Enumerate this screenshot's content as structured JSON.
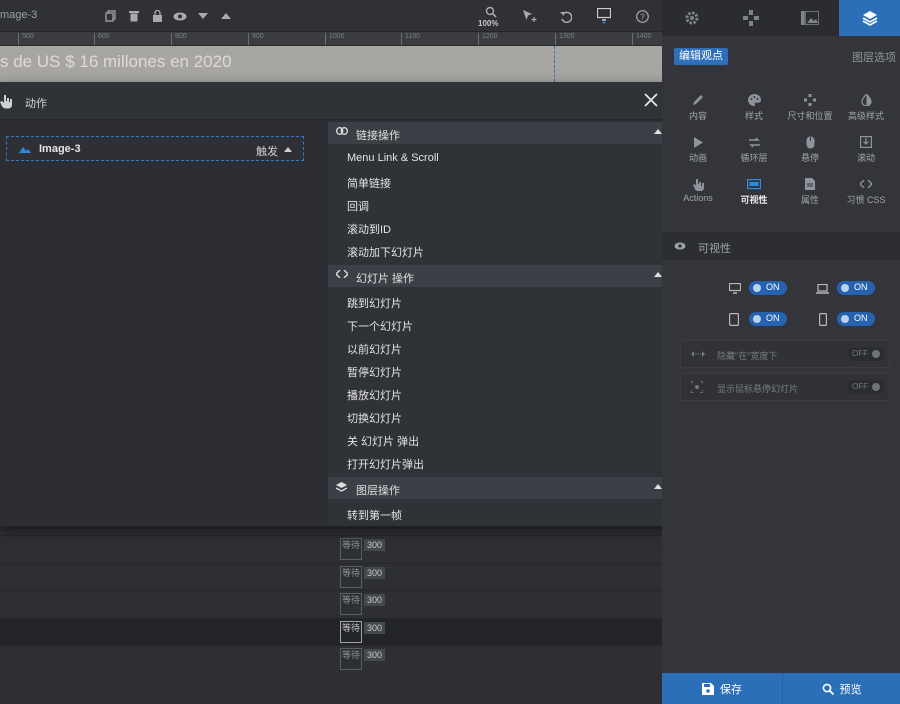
{
  "toolbar": {
    "layer_title": "mage-3",
    "zoom": "100%"
  },
  "ruler": {
    "ticks": [
      "500",
      "600",
      "800",
      "900",
      "1000",
      "1100",
      "1200",
      "1300",
      "1400"
    ]
  },
  "canvas": {
    "headline": "s de US $ 16 millones en 2020"
  },
  "modal": {
    "title": "动作",
    "trigger": {
      "layer_name": "Image-3",
      "trigger_label": "触发"
    },
    "sections": [
      {
        "title": "链接操作",
        "icon": "link-icon",
        "items": [
          "Menu Link & Scroll",
          "简单链接",
          "回调",
          "滚动到ID",
          "滚动加下幻灯片"
        ]
      },
      {
        "title": "幻灯片 操作",
        "icon": "code-icon",
        "items": [
          "跳到幻灯片",
          "下一个幻灯片",
          "以前幻灯片",
          "暂停幻灯片",
          "播放幻灯片",
          "切换幻灯片",
          "关 幻灯片 弹出",
          "打开幻灯片弹出"
        ]
      },
      {
        "title": "图层操作",
        "icon": "layers-icon",
        "items": [
          "转到第一帧"
        ]
      }
    ]
  },
  "timeline": {
    "rows": [
      {
        "wait": "等待",
        "ms": "300"
      },
      {
        "wait": "等待",
        "ms": "300"
      },
      {
        "wait": "等待",
        "ms": "300"
      },
      {
        "wait": "等待",
        "ms": "300"
      },
      {
        "wait": "等待",
        "ms": "300"
      }
    ]
  },
  "panel": {
    "edit_viewport": "编辑观点",
    "layer_options": "图层选项",
    "props": [
      {
        "label": "内容",
        "icon": "pencil-icon"
      },
      {
        "label": "样式",
        "icon": "palette-icon"
      },
      {
        "label": "尺寸和位置",
        "icon": "move-icon"
      },
      {
        "label": "高级样式",
        "icon": "contrast-icon"
      },
      {
        "label": "动画",
        "icon": "play-icon"
      },
      {
        "label": "循环层",
        "icon": "loop-icon"
      },
      {
        "label": "悬停",
        "icon": "mouse-icon"
      },
      {
        "label": "滚动",
        "icon": "scroll-icon"
      },
      {
        "label": "Actions",
        "icon": "hand-icon"
      },
      {
        "label": "可视性",
        "icon": "visibility-icon"
      },
      {
        "label": "属性",
        "icon": "document-icon"
      },
      {
        "label": "习惯 CSS",
        "icon": "css-icon"
      }
    ],
    "visibility": {
      "title": "可视性",
      "toggles": [
        "ON",
        "ON",
        "ON",
        "ON"
      ],
      "hide_under": "隐藏\"在\"宽度下",
      "hide_under_state": "OFF",
      "show_on_hover": "显示鼠标悬停幻灯片",
      "show_on_hover_state": "OFF"
    },
    "save": "保存",
    "preview": "预览"
  },
  "colors": {
    "accent": "#2b6fb9",
    "canvas_bg": "#a8a6a2"
  }
}
